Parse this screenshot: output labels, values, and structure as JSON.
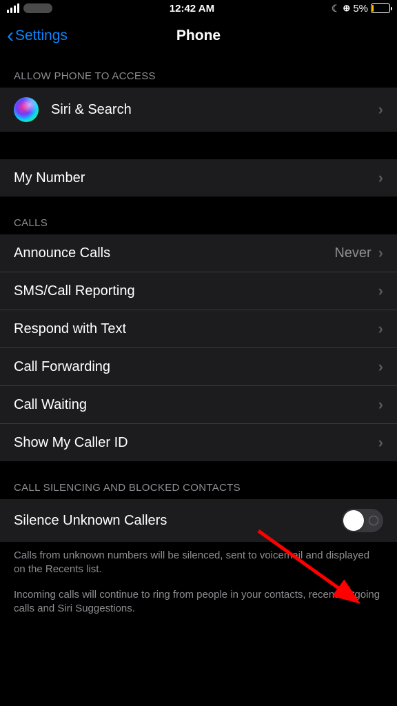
{
  "statusBar": {
    "time": "12:42 AM",
    "batteryPercent": "5%"
  },
  "nav": {
    "backLabel": "Settings",
    "title": "Phone"
  },
  "sections": {
    "accessHeader": "ALLOW PHONE TO ACCESS",
    "siriSearch": "Siri & Search",
    "myNumber": "My Number",
    "callsHeader": "CALLS",
    "announceCalls": {
      "label": "Announce Calls",
      "value": "Never"
    },
    "smsCallReporting": "SMS/Call Reporting",
    "respondWithText": "Respond with Text",
    "callForwarding": "Call Forwarding",
    "callWaiting": "Call Waiting",
    "showCallerId": "Show My Caller ID",
    "silencingHeader": "CALL SILENCING AND BLOCKED CONTACTS",
    "silenceUnknown": "Silence Unknown Callers",
    "footer1": "Calls from unknown numbers will be silenced, sent to voicemail and displayed on the Recents list.",
    "footer2": "Incoming calls will continue to ring from people in your contacts, recent outgoing calls and Siri Suggestions."
  }
}
